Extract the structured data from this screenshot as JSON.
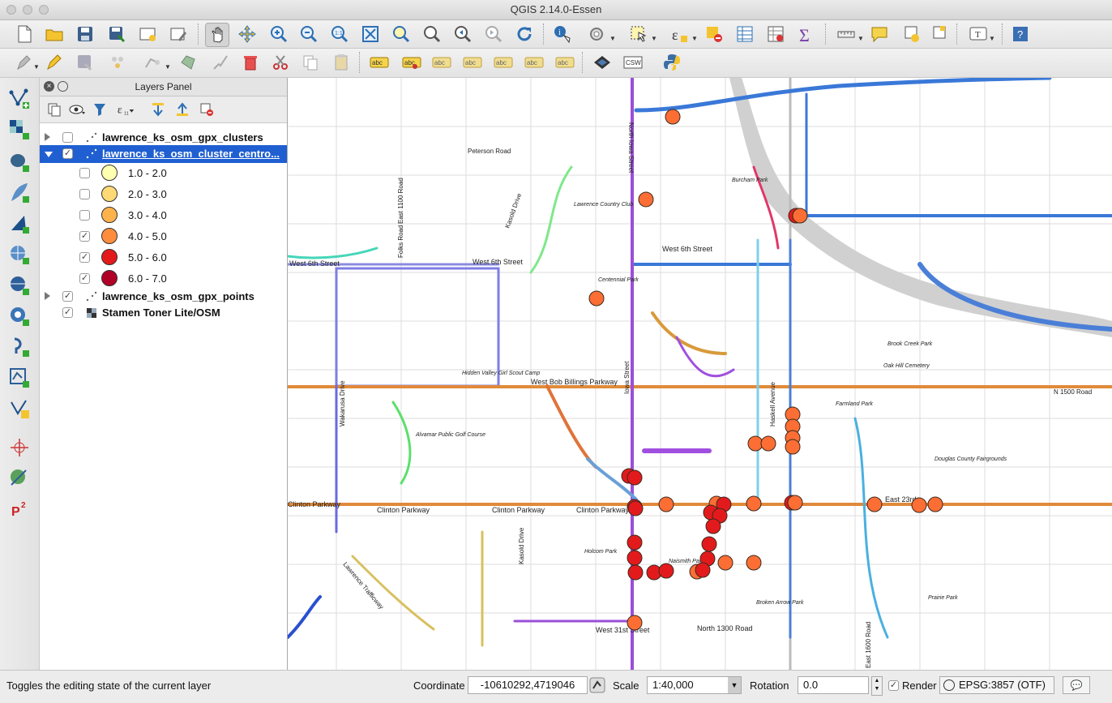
{
  "window": {
    "title": "QGIS 2.14.0-Essen"
  },
  "layers_panel": {
    "title": "Layers Panel",
    "layers": [
      {
        "name": "lawrence_ks_osm_gpx_clusters",
        "checked": false,
        "expanded": false
      },
      {
        "name": "lawrence_ks_osm_cluster_centro...",
        "checked": true,
        "expanded": true,
        "selected": true
      },
      {
        "name": "lawrence_ks_osm_gpx_points",
        "checked": true,
        "expanded": false
      },
      {
        "name": "Stamen Toner Lite/OSM",
        "checked": true,
        "expanded": false
      }
    ],
    "legend": [
      {
        "label": "1.0 - 2.0",
        "checked": false,
        "color": "#ffffb2"
      },
      {
        "label": "2.0 - 3.0",
        "checked": false,
        "color": "#fed976"
      },
      {
        "label": "3.0 - 4.0",
        "checked": false,
        "color": "#feb24c"
      },
      {
        "label": "4.0 - 5.0",
        "checked": true,
        "color": "#fd8d3c"
      },
      {
        "label": "5.0 - 6.0",
        "checked": true,
        "color": "#e31a1c"
      },
      {
        "label": "6.0 - 7.0",
        "checked": true,
        "color": "#b10026"
      }
    ]
  },
  "map": {
    "labels": [
      "Peterson Road",
      "North Iowa Street",
      "East 1100 Road",
      "Folks Road",
      "Kasold Drive",
      "Lawrence Country Club",
      "Burcham Park",
      "West 6th Street",
      "West 6th Street",
      "West 6th Street",
      "Centennial Park",
      "Brook Creek Park",
      "Oak Hill Cemetery",
      "N 1500 Road",
      "Farmland Park",
      "Hidden Valley Girl Scout Camp",
      "West Bob Billings Parkway",
      "Alvamar Public Golf Course",
      "Wakarusa Drive",
      "Iowa Street",
      "Clinton Parkway",
      "Clinton Parkway",
      "Clinton Parkway",
      "Clinton Parkway",
      "East 23rd",
      "Douglas County Fairgrounds",
      "Kasold Drive",
      "Naismith Park",
      "Prairie Park",
      "West 31st Street",
      "North 1300 Road",
      "Lawrence Trafficway",
      "East 1600 Road",
      "Broken Arrow Park",
      "Holcom Park",
      "Haskell Avenue"
    ],
    "marker_fill": "#fd6e34",
    "marker_fill_dark": "#e31a1c"
  },
  "status_bar": {
    "message": "Toggles the editing state of the current layer",
    "coordinate_label": "Coordinate",
    "coordinate_value": "-10610292,4719046",
    "scale_label": "Scale",
    "scale_value": "1:40,000",
    "rotation_label": "Rotation",
    "rotation_value": "0.0",
    "render_label": "Render",
    "render_checked": true,
    "crs": "EPSG:3857 (OTF)"
  },
  "icons": {
    "toolbar_row1": [
      "new-project-icon",
      "open-project-icon",
      "save-project-icon",
      "save-as-icon",
      "new-print-composer-icon",
      "composer-manager-icon",
      "pan-icon",
      "pan-to-selection-icon",
      "zoom-in-icon",
      "zoom-out-icon",
      "zoom-native-icon",
      "zoom-full-icon",
      "zoom-to-selection-icon",
      "zoom-to-layer-icon",
      "zoom-last-icon",
      "zoom-next-icon",
      "refresh-icon",
      "identify-icon",
      "run-action-icon",
      "select-features-icon",
      "select-by-expression-icon",
      "deselect-icon",
      "attribute-table-icon",
      "field-calculator-icon",
      "statistics-icon",
      "measure-icon",
      "map-tips-icon",
      "new-bookmark-icon",
      "show-bookmarks-icon",
      "text-annotation-icon",
      "help-icon"
    ],
    "toolbar_row2": [
      "current-edits-icon",
      "toggle-editing-icon",
      "save-edits-icon",
      "add-feature-icon",
      "move-feature-icon",
      "node-tool-icon",
      "delete-selected-icon",
      "cut-features-icon",
      "copy-features-icon",
      "paste-features-icon",
      "label-icon",
      "pin-labels-icon",
      "highlight-pinned-labels-icon",
      "show-hide-labels-icon",
      "move-label-icon",
      "rotate-label-icon",
      "change-label-icon",
      "geopackage-icon",
      "csw-icon",
      "python-console-icon"
    ]
  }
}
